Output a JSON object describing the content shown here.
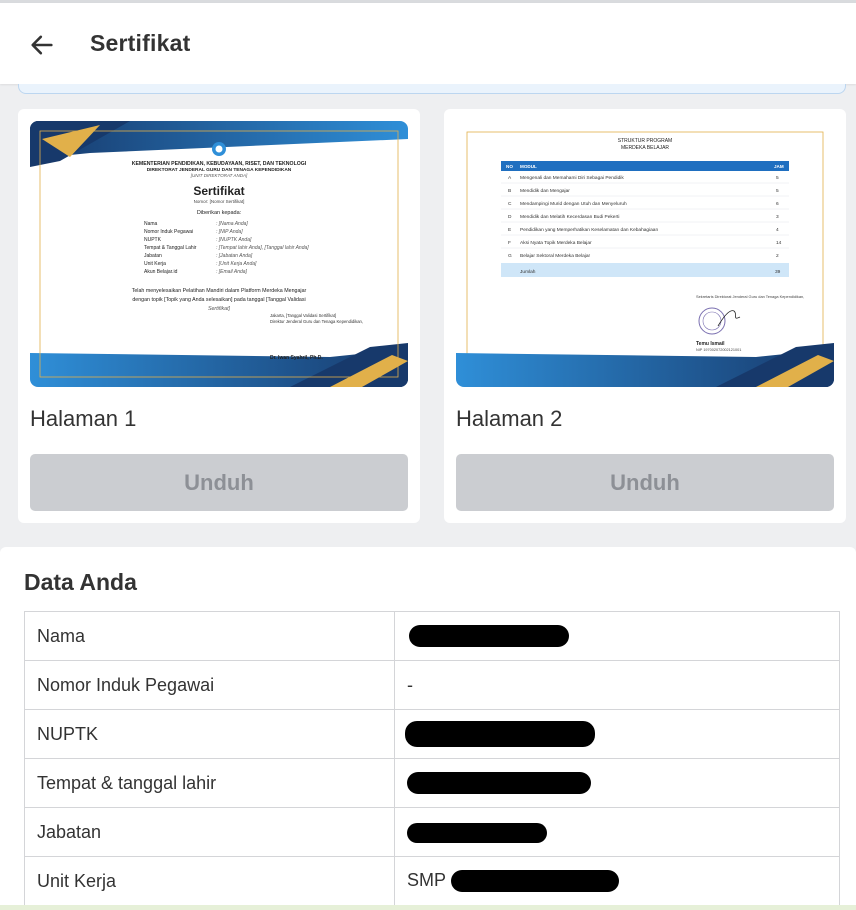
{
  "appbar": {
    "title": "Sertifikat"
  },
  "pages": [
    {
      "label": "Halaman 1",
      "button": "Unduh"
    },
    {
      "label": "Halaman 2",
      "button": "Unduh"
    }
  ],
  "page1": {
    "ministry": "KEMENTERIAN PENDIDIKAN, KEBUDAYAAN, RISET, DAN TEKNOLOGI",
    "directorate": "DIREKTORAT JENDERAL GURU DAN TENAGA KEPENDIDIKAN",
    "unit": "[UNIT DIREKTORAT ANDA]",
    "title": "Sertifikat",
    "number": "Nomor: [Nomor Sertifikat]",
    "given_to": "Diberikan kepada:",
    "fields": [
      {
        "k": "Nama",
        "v": ": [Nama Anda]"
      },
      {
        "k": "Nomor Induk Pegawai",
        "v": ": [NIP Anda]"
      },
      {
        "k": "NUPTK",
        "v": ": [NUPTK Anda]"
      },
      {
        "k": "Tempat & Tanggal Lahir",
        "v": ": [Tempat lahir Anda], [Tanggal lahir Anda]"
      },
      {
        "k": "Jabatan",
        "v": ": [Jabatan Anda]"
      },
      {
        "k": "Unit Kerja",
        "v": ": [Unit Kerja Anda]"
      },
      {
        "k": "Akun Belajar.id",
        "v": ": [Email Anda]"
      }
    ],
    "body1": "Telah menyelesaikan Pelatihan Mandiri dalam Platform Merdeka Mengajar",
    "body2": "dengan topik [Topik yang Anda selesaikan] pada tanggal [Tanggal Validasi",
    "body3": "Sertifikat]",
    "sign_place": "Jakarta, [Tanggal Validasi Sertifikat]",
    "sign_role": "Direktur Jenderal Guru dan Tenaga Kependidikan,",
    "sign_name": "Dr. Iwan Syahril, Ph.D."
  },
  "page2": {
    "title1": "STRUKTUR PROGRAM",
    "title2": "MERDEKA BELAJAR",
    "head": {
      "no": "NO",
      "modul": "MODUL",
      "jam": "JAM"
    },
    "rows": [
      {
        "no": "A",
        "modul": "Mengenali dan Memahami Diri Sebagai Pendidik",
        "jam": "5"
      },
      {
        "no": "B",
        "modul": "Mendidik dan Mengajar",
        "jam": "5"
      },
      {
        "no": "C",
        "modul": "Mendampingi Murid dengan Utuh dan Menyeluruh",
        "jam": "6"
      },
      {
        "no": "D",
        "modul": "Mendidik dan Melatih Kecerdasan Budi Pekerti",
        "jam": "3"
      },
      {
        "no": "E",
        "modul": "Pendidikan yang Memperhatikan Keselamatan dan Kebahagiaan",
        "jam": "4"
      },
      {
        "no": "F",
        "modul": "Aksi Nyata Topik Merdeka Belajar",
        "jam": "14"
      },
      {
        "no": "G",
        "modul": "Belajar Sektoral Merdeka Belajar",
        "jam": "2"
      }
    ],
    "total_label": "Jumlah",
    "total": "39",
    "sign_role": "Sekretaris Direktorat Jenderal Guru dan Tenaga Kependidikan,",
    "sign_name": "Temu Ismail",
    "sign_nip": "NIP 197002072002121001"
  },
  "data": {
    "title": "Data Anda",
    "rows": [
      {
        "label": "Nama",
        "value": ""
      },
      {
        "label": "Nomor Induk Pegawai",
        "value": "-"
      },
      {
        "label": "NUPTK",
        "value": ""
      },
      {
        "label": "Tempat & tanggal lahir",
        "value": ""
      },
      {
        "label": "Jabatan",
        "value": ""
      },
      {
        "label": "Unit Kerja",
        "value": "SMP"
      }
    ]
  },
  "colors": {
    "primary_blue": "#1f6fc0",
    "navy": "#17396b",
    "gold": "#e1b04a",
    "button_disabled": "#cbcdd1"
  }
}
